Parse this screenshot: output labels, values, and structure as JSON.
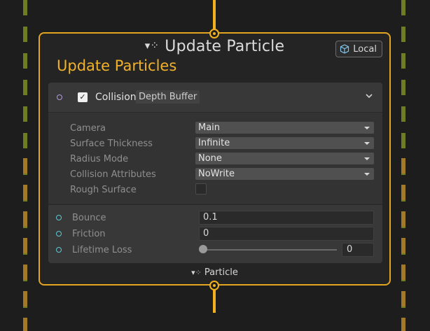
{
  "node": {
    "title": "Update Particle",
    "title_icon": "particle-dots-icon",
    "space_badge": "Local",
    "subtitle": "Update Particles",
    "footer_label": "Particle"
  },
  "block": {
    "enabled": true,
    "title": "Collision",
    "subtitle": "Depth Buffer",
    "settings": [
      {
        "label": "Camera",
        "kind": "dropdown",
        "value": "Main"
      },
      {
        "label": "Surface Thickness",
        "kind": "dropdown",
        "value": "Infinite"
      },
      {
        "label": "Radius Mode",
        "kind": "dropdown",
        "value": "None"
      },
      {
        "label": "Collision Attributes",
        "kind": "dropdown",
        "value": "NoWrite"
      },
      {
        "label": "Rough Surface",
        "kind": "checkbox",
        "value": false
      }
    ],
    "properties": [
      {
        "label": "Bounce",
        "value": "0.1"
      },
      {
        "label": "Friction",
        "value": "0"
      },
      {
        "label": "Lifetime Loss",
        "value": "0",
        "slider_fraction": 0.0
      }
    ]
  },
  "colors": {
    "accent": "#e3a41f",
    "flow_wire": "#f2b11c",
    "slot_purple": "#b39bdc",
    "slot_cyan": "#5bc9d6"
  }
}
